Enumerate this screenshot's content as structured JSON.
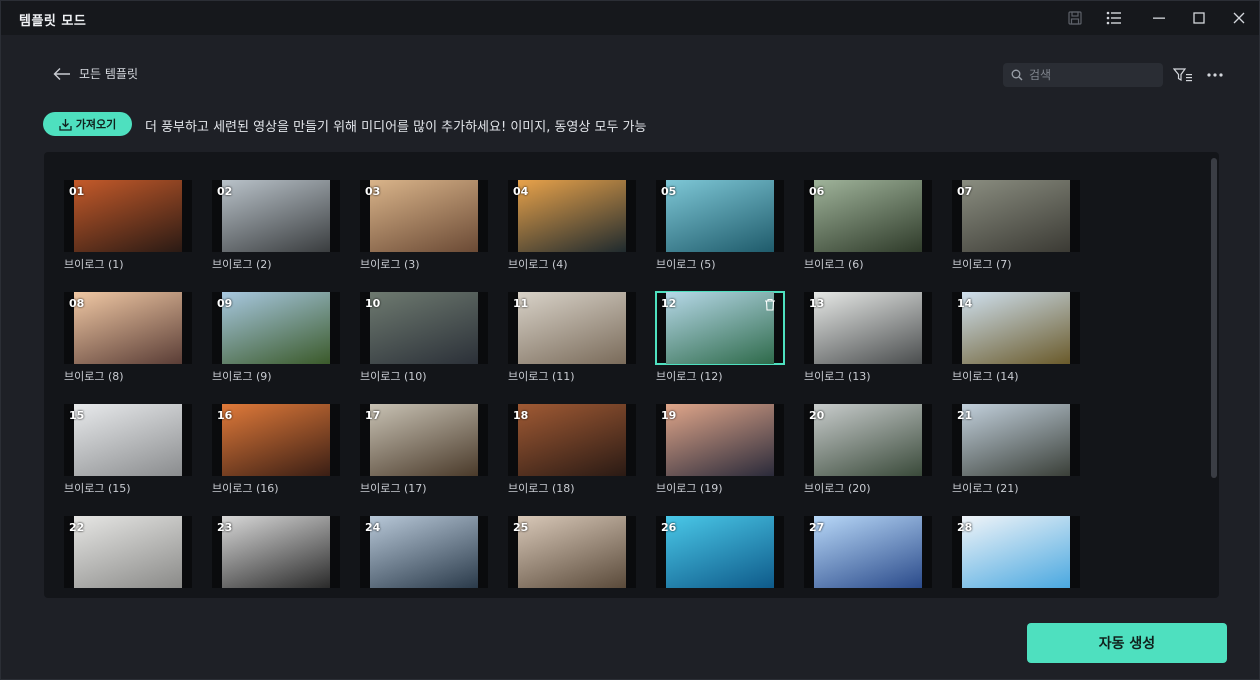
{
  "window": {
    "title": "템플릿 모드"
  },
  "nav": {
    "back_label": "모든 템플릿"
  },
  "search": {
    "placeholder": "검색"
  },
  "import": {
    "label": "가져오기",
    "hint": "더 풍부하고 세련된 영상을 만들기 위해 미디어를 많이 추가하세요! 이미지, 동영상 모두 가능"
  },
  "templates": [
    {
      "num": "01",
      "label": "브이로그 (1)",
      "g1": "#2a1a14",
      "g2": "#c45a2a"
    },
    {
      "num": "02",
      "label": "브이로그 (2)",
      "g1": "#3a3d3f",
      "g2": "#b9c2c9"
    },
    {
      "num": "03",
      "label": "브이로그 (3)",
      "g1": "#6b4a35",
      "g2": "#d9b48a"
    },
    {
      "num": "04",
      "label": "브이로그 (4)",
      "g1": "#1f2a2e",
      "g2": "#e8a24a"
    },
    {
      "num": "05",
      "label": "브이로그 (5)",
      "g1": "#1f5b6b",
      "g2": "#7ec7d6"
    },
    {
      "num": "06",
      "label": "브이로그 (6)",
      "g1": "#2f3b2a",
      "g2": "#9fb39a"
    },
    {
      "num": "07",
      "label": "브이로그 (7)",
      "g1": "#3b3a34",
      "g2": "#8a8d80"
    },
    {
      "num": "08",
      "label": "브이로그 (8)",
      "g1": "#5a3d36",
      "g2": "#f0c8a4"
    },
    {
      "num": "09",
      "label": "브이로그 (9)",
      "g1": "#3b5a2a",
      "g2": "#a8c8e0"
    },
    {
      "num": "10",
      "label": "브이로그 (10)",
      "g1": "#2b3038",
      "g2": "#6e7a70"
    },
    {
      "num": "11",
      "label": "브이로그 (11)",
      "g1": "#7a6b5a",
      "g2": "#d8d2c8"
    },
    {
      "num": "12",
      "label": "브이로그 (12)",
      "g1": "#2e6a4a",
      "g2": "#b6d8e8"
    },
    {
      "num": "13",
      "label": "브이로그 (13)",
      "g1": "#4a4d4e",
      "g2": "#e6e8e6"
    },
    {
      "num": "14",
      "label": "브이로그 (14)",
      "g1": "#6a5a2a",
      "g2": "#cfe0ee"
    },
    {
      "num": "15",
      "label": "브이로그 (15)",
      "g1": "#8a8c8e",
      "g2": "#e8eaec"
    },
    {
      "num": "16",
      "label": "브이로그 (16)",
      "g1": "#3a1e14",
      "g2": "#e07a3a"
    },
    {
      "num": "17",
      "label": "브이로그 (17)",
      "g1": "#4a3a2a",
      "g2": "#c8c2b4"
    },
    {
      "num": "18",
      "label": "브이로그 (18)",
      "g1": "#2a1a14",
      "g2": "#a05a34"
    },
    {
      "num": "19",
      "label": "브이로그 (19)",
      "g1": "#2a2a3a",
      "g2": "#e0a68a"
    },
    {
      "num": "20",
      "label": "브이로그 (20)",
      "g1": "#3a4a3a",
      "g2": "#c8cccc"
    },
    {
      "num": "21",
      "label": "브이로그 (21)",
      "g1": "#3a3f38",
      "g2": "#c2d0dc"
    },
    {
      "num": "22",
      "label": "",
      "g1": "#8a8a88",
      "g2": "#e6e6e4"
    },
    {
      "num": "23",
      "label": "",
      "g1": "#2a2a2a",
      "g2": "#d8d8d8"
    },
    {
      "num": "24",
      "label": "",
      "g1": "#2a3a4a",
      "g2": "#b8c8d8"
    },
    {
      "num": "25",
      "label": "",
      "g1": "#5a4a3a",
      "g2": "#d8c8b8"
    },
    {
      "num": "26",
      "label": "",
      "g1": "#0e5a8a",
      "g2": "#4ac8e8"
    },
    {
      "num": "27",
      "label": "",
      "g1": "#2a4a8a",
      "g2": "#b8d8f8"
    },
    {
      "num": "28",
      "label": "",
      "g1": "#4aa8e0",
      "g2": "#f0f4f8"
    }
  ],
  "selected_index": 11,
  "actions": {
    "auto_generate": "자동 생성"
  },
  "colors": {
    "accent": "#4ee0bf",
    "background": "#1e2026",
    "panel": "#131519"
  }
}
